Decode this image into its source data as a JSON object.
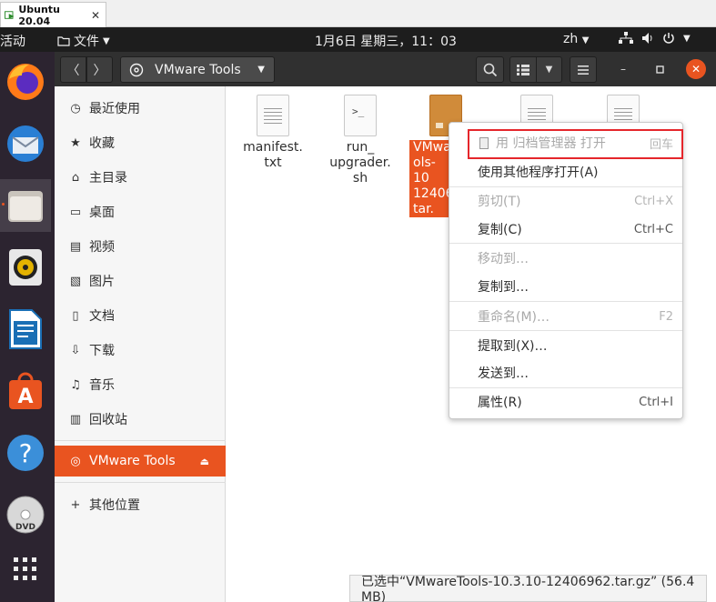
{
  "vm_tab": {
    "title": "Ubuntu 20.04",
    "close": "✕"
  },
  "topbar": {
    "activities": "活动",
    "app_menu": "文件",
    "clock": "1月6日 星期三，11：03",
    "lang": "zh"
  },
  "header": {
    "location": "VMware Tools"
  },
  "sidebar": {
    "items": [
      {
        "label": "最近使用",
        "icon": "clock-icon"
      },
      {
        "label": "收藏",
        "icon": "star-icon"
      },
      {
        "label": "主目录",
        "icon": "home-icon"
      },
      {
        "label": "桌面",
        "icon": "desktop-icon"
      },
      {
        "label": "视频",
        "icon": "video-icon"
      },
      {
        "label": "图片",
        "icon": "picture-icon"
      },
      {
        "label": "文档",
        "icon": "document-icon"
      },
      {
        "label": "下载",
        "icon": "download-icon"
      },
      {
        "label": "音乐",
        "icon": "music-icon"
      },
      {
        "label": "回收站",
        "icon": "trash-icon"
      }
    ],
    "device": {
      "label": "VMware Tools",
      "icon": "disc-icon"
    },
    "other": {
      "label": "其他位置",
      "icon": "plus-icon"
    }
  },
  "files": [
    {
      "name": "manifest.\ntxt",
      "type": "text"
    },
    {
      "name": "run_\nupgrader.\nsh",
      "type": "script"
    },
    {
      "name": "VMwa\nols-10\n12406\ntar.",
      "type": "archive",
      "selected": true
    },
    {
      "name": "",
      "type": "text"
    },
    {
      "name": "",
      "type": "text"
    }
  ],
  "context_menu": {
    "items": [
      {
        "label": "用 归档管理器 打开",
        "accel": "回车",
        "disabled": true
      },
      {
        "label": "使用其他程序打开(A)",
        "accel": "",
        "disabled": false
      },
      {
        "label": "剪切(T)",
        "accel": "Ctrl+X",
        "disabled": true
      },
      {
        "label": "复制(C)",
        "accel": "Ctrl+C",
        "disabled": false
      },
      {
        "label": "移动到…",
        "accel": "",
        "disabled": true
      },
      {
        "label": "复制到…",
        "accel": "",
        "disabled": false
      },
      {
        "label": "重命名(M)…",
        "accel": "F2",
        "disabled": true
      },
      {
        "label": "提取到(X)…",
        "accel": "",
        "disabled": false
      },
      {
        "label": "发送到…",
        "accel": "",
        "disabled": false
      },
      {
        "label": "属性(R)",
        "accel": "Ctrl+I",
        "disabled": false
      }
    ]
  },
  "status": {
    "text": "已选中“VMwareTools-10.3.10-12406962.tar.gz” (56.4 MB)"
  },
  "colors": {
    "accent": "#e95420",
    "highlight_box": "#e5262b",
    "topbar": "#1d1d1d",
    "dock": "#2c2430"
  }
}
